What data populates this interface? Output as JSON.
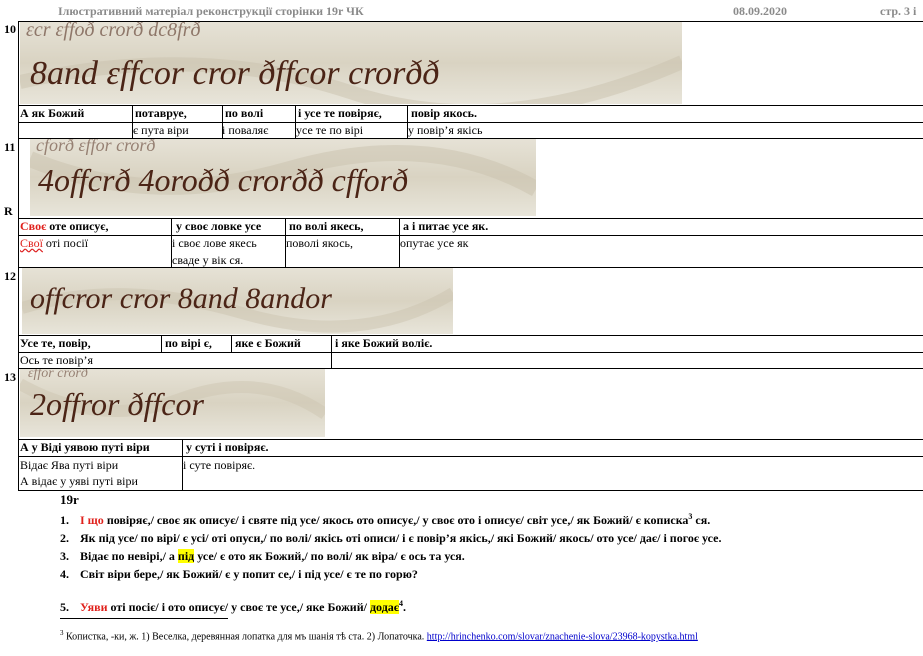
{
  "header": {
    "title": "Ілюстративний матеріал  реконструкції сторінки 19r  ЧК",
    "date": "08.09.2020",
    "page": "стр. 3 і"
  },
  "rows": [
    {
      "number": "10",
      "manuscript": "8and ɛffcor cror ðffcor crorðð",
      "cols": [
        {
          "bold": "А як Божий",
          "plain": ""
        },
        {
          "bold": "потавруе,",
          "plain": "є пута віри"
        },
        {
          "bold": "по волі",
          "plain": "і поваляє"
        },
        {
          "bold": "і усе те повіряє,",
          "plain": "усе те по вірі"
        },
        {
          "bold": "повір якось.",
          "plain": "у повір’я якісь"
        }
      ]
    },
    {
      "number": "11",
      "marker": "R",
      "manuscript": "4offcrð 4oroðð crorðð cfforð",
      "cols": [
        {
          "bold_red": "Своє",
          "bold": " оте описує,",
          "plain_red": "Свої",
          "plain": " оті посії"
        },
        {
          "bold": "у своє ловке усе",
          "plain": "і своє лове якесь",
          "plain2": "сваде у  вік ся."
        },
        {
          "bold": "по волі якесь,",
          "plain": "поволі  якось,"
        },
        {
          "bold": "а і питає усе як.",
          "plain": "опутає усе як"
        }
      ]
    },
    {
      "number": "12",
      "manuscript": "offcror cror 8and 8andor",
      "cols": [
        {
          "bold": "Усе те, повір,",
          "plain": "Ось те повір’я"
        },
        {
          "bold": "по вірі є,",
          "plain": ""
        },
        {
          "bold": "яке є Божий",
          "plain": ""
        },
        {
          "bold": "і яке Божий воліє.",
          "plain": ""
        }
      ]
    },
    {
      "number": "13",
      "manuscript": "2offror ðffcor",
      "cols": [
        {
          "bold": "А у Віді уявою путі віри",
          "plain": "Відає Ява путі віри",
          "plain2": "А відає у уяві путі віри"
        },
        {
          "bold": "у суті і повіряє.",
          "plain": "і суте повіряє."
        }
      ]
    }
  ],
  "section": {
    "label": "19r",
    "items": [
      {
        "num": "1.",
        "red": "І що",
        "text": " повіряє,/ своє як описує/ і святе під усе/ якось ото описує,/ у своє ото і описує/ світ усе,/ як Божий/ є кописка",
        "sup": "3",
        "tail": " ся."
      },
      {
        "num": "2.",
        "red": "",
        "text": "Як під усе/ по вірі/ є усі/ оті опуси,/ по волі/ якісь оті описи/ і є повір’я якісь,/ які Божий/ якось/ ото усе/ дає/ і погоє усе."
      },
      {
        "num": "3.",
        "red": "",
        "text": "Відає по невірі,/ а ",
        "hl": "під",
        "tail": " усе/ є ото як Божий,/ по волі/ як віра/ є ось та уся."
      },
      {
        "num": "4.",
        "red": "",
        "text": "Світ віри бере,/ як Божий/ є у попит се,/ і під усе/ є те по горю?"
      },
      {
        "num": "5.",
        "red": "Уяви",
        "text": " оті посіє/ і ото описує/ у своє те усе,/ яке Божий/ ",
        "hl": "додає",
        "sup": "4",
        "tail": "."
      }
    ]
  },
  "footnote": {
    "mark": "3",
    "text": " Копистка, -ки, ж. 1) Веселка, деревянная лопатка для мъ шанія тѣ ста. 2) Лопаточка. ",
    "link": "http://hrinchenko.com/slovar/znachenie-slova/23968-kopystka.html"
  }
}
